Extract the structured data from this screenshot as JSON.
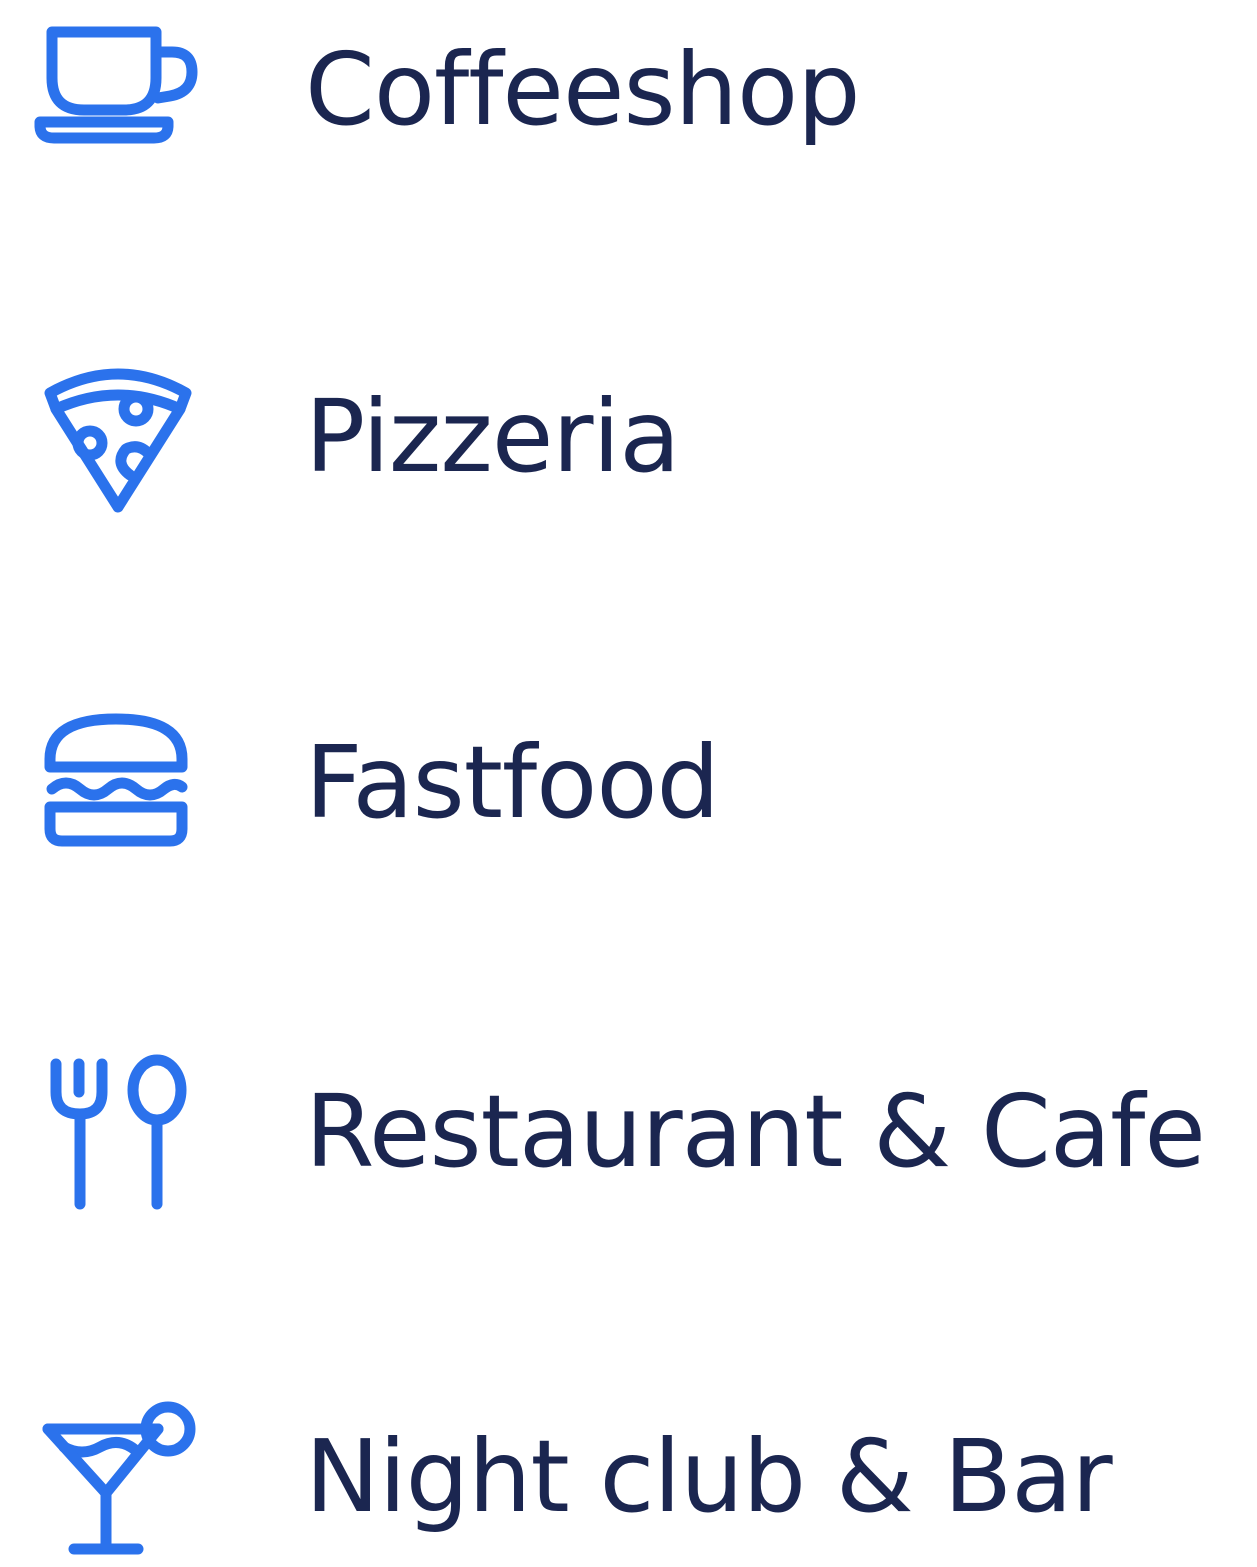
{
  "accent_color": "#2b72ec",
  "text_color": "#1b2650",
  "categories": [
    {
      "label": "Coffeeshop",
      "icon": "coffee-cup-icon"
    },
    {
      "label": "Pizzeria",
      "icon": "pizza-slice-icon"
    },
    {
      "label": "Fastfood",
      "icon": "burger-icon"
    },
    {
      "label": "Restaurant & Cafe",
      "icon": "fork-spoon-icon"
    },
    {
      "label": "Night club & Bar",
      "icon": "cocktail-icon"
    }
  ]
}
